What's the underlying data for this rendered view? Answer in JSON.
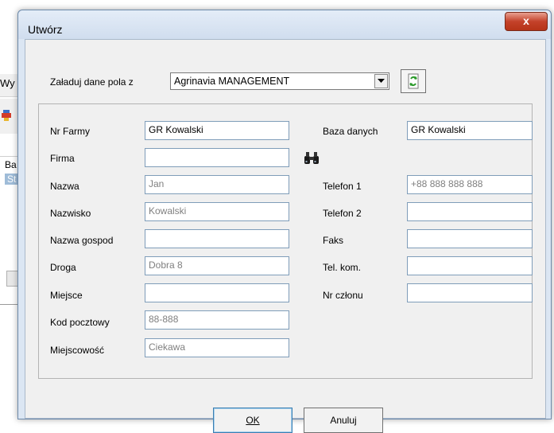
{
  "background_app": {
    "menu_fragment": "Wy",
    "list_header": "Ba",
    "list_item": "St"
  },
  "dialog": {
    "title": "Utwórz",
    "close_label": "x",
    "load_label": "Załaduj dane pola z",
    "load_selected": "Agrinavia MANAGEMENT",
    "fields_left": [
      {
        "label": "Nr Farmy",
        "value": "GR Kowalski",
        "style": "dark"
      },
      {
        "label": "Firma",
        "value": "",
        "style": "dark"
      },
      {
        "label": "Nazwa",
        "value": "Jan",
        "style": "grey"
      },
      {
        "label": "Nazwisko",
        "value": "Kowalski",
        "style": "grey"
      },
      {
        "label": "Nazwa gospod",
        "value": "",
        "style": "dark"
      },
      {
        "label": "Droga",
        "value": "Dobra 8",
        "style": "grey"
      },
      {
        "label": "Miejsce",
        "value": "",
        "style": "dark"
      },
      {
        "label": "Kod pocztowy",
        "value": "88-888",
        "style": "grey"
      },
      {
        "label": "Miejscowość",
        "value": "Ciekawa",
        "style": "grey"
      }
    ],
    "database_label": "Baza danych",
    "database_value": "GR Kowalski",
    "fields_right": [
      {
        "label": "Telefon 1",
        "value": "+88 888 888 888",
        "style": "grey"
      },
      {
        "label": "Telefon 2",
        "value": "",
        "style": "dark"
      },
      {
        "label": "Faks",
        "value": "",
        "style": "dark"
      },
      {
        "label": "Tel. kom.",
        "value": "",
        "style": "dark"
      },
      {
        "label": "Nr członu",
        "value": "",
        "style": "dark"
      }
    ],
    "ok_label": "OK",
    "cancel_label": "Anuluj"
  }
}
